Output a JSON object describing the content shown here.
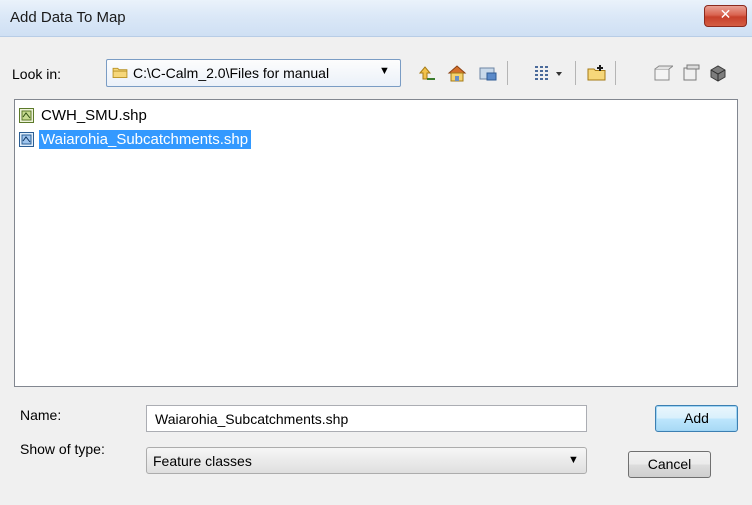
{
  "window": {
    "title": "Add Data To Map",
    "close_label": "✕"
  },
  "lookin": {
    "label": "Look in:",
    "value": "C:\\C-Calm_2.0\\Files for manual"
  },
  "toolbar": {
    "icons": [
      "up-one-level-icon",
      "home-icon",
      "connect-folder-icon",
      "view-options-icon",
      "new-folder-icon",
      "new-item-icon",
      "new-database-icon",
      "geodatabase-icon"
    ]
  },
  "files": [
    {
      "name": "CWH_SMU.shp",
      "selected": false
    },
    {
      "name": "Waiarohia_Subcatchments.shp",
      "selected": true
    }
  ],
  "name_field": {
    "label": "Name:",
    "value": "Waiarohia_Subcatchments.shp"
  },
  "type_field": {
    "label": "Show of type:",
    "value": "Feature classes"
  },
  "buttons": {
    "add": "Add",
    "cancel": "Cancel"
  },
  "colors": {
    "selection": "#3399ff",
    "titlebar": "#dbe8f7",
    "close": "#c7402b"
  }
}
